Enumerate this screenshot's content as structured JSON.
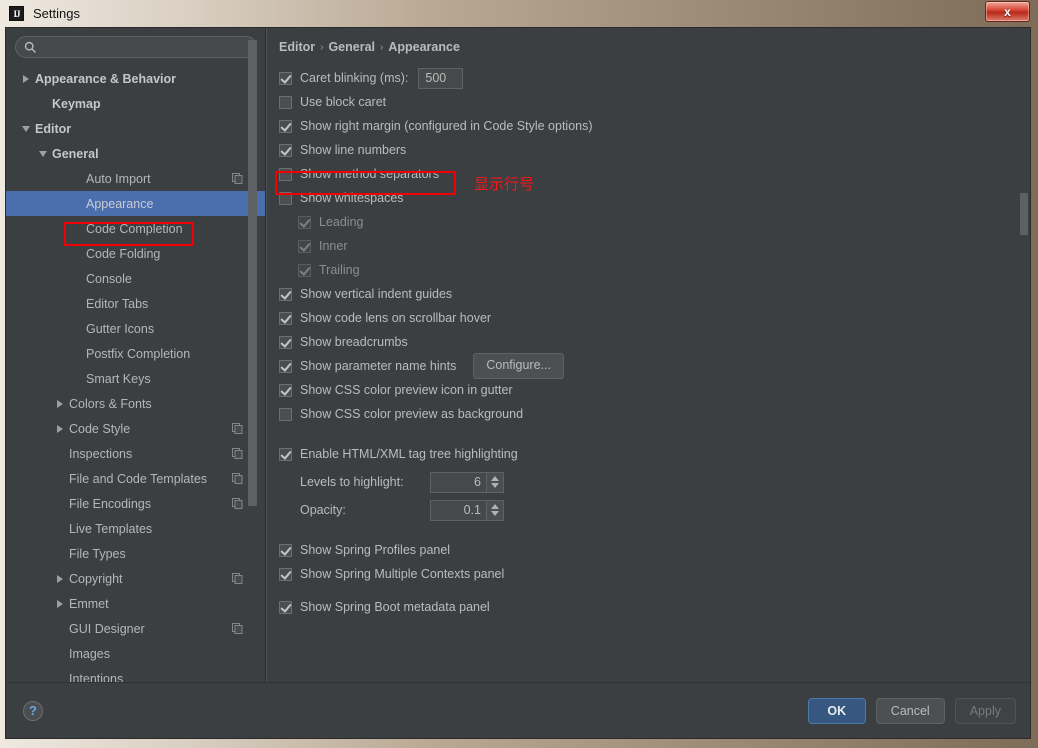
{
  "window": {
    "title": "Settings",
    "app_icon": "intellij-idea-icon",
    "close_label": "x"
  },
  "search": {
    "value": "",
    "placeholder": "",
    "icon": "search-icon"
  },
  "sidebar": {
    "items": [
      {
        "label": "Appearance & Behavior",
        "indent": 0,
        "arrow": "collapsed",
        "bold": true,
        "copy": false,
        "selected": false
      },
      {
        "label": "Keymap",
        "indent": 1,
        "arrow": "none",
        "bold": true,
        "copy": false,
        "selected": false
      },
      {
        "label": "Editor",
        "indent": 0,
        "arrow": "expanded",
        "bold": true,
        "copy": false,
        "selected": false
      },
      {
        "label": "General",
        "indent": 1,
        "arrow": "expanded",
        "bold": true,
        "copy": false,
        "selected": false
      },
      {
        "label": "Auto Import",
        "indent": 3,
        "arrow": "none",
        "bold": false,
        "copy": true,
        "selected": false
      },
      {
        "label": "Appearance",
        "indent": 3,
        "arrow": "none",
        "bold": false,
        "copy": false,
        "selected": true
      },
      {
        "label": "Code Completion",
        "indent": 3,
        "arrow": "none",
        "bold": false,
        "copy": false,
        "selected": false
      },
      {
        "label": "Code Folding",
        "indent": 3,
        "arrow": "none",
        "bold": false,
        "copy": false,
        "selected": false
      },
      {
        "label": "Console",
        "indent": 3,
        "arrow": "none",
        "bold": false,
        "copy": false,
        "selected": false
      },
      {
        "label": "Editor Tabs",
        "indent": 3,
        "arrow": "none",
        "bold": false,
        "copy": false,
        "selected": false
      },
      {
        "label": "Gutter Icons",
        "indent": 3,
        "arrow": "none",
        "bold": false,
        "copy": false,
        "selected": false
      },
      {
        "label": "Postfix Completion",
        "indent": 3,
        "arrow": "none",
        "bold": false,
        "copy": false,
        "selected": false
      },
      {
        "label": "Smart Keys",
        "indent": 3,
        "arrow": "none",
        "bold": false,
        "copy": false,
        "selected": false
      },
      {
        "label": "Colors & Fonts",
        "indent": 2,
        "arrow": "collapsed",
        "bold": false,
        "copy": false,
        "selected": false
      },
      {
        "label": "Code Style",
        "indent": 2,
        "arrow": "collapsed",
        "bold": false,
        "copy": true,
        "selected": false
      },
      {
        "label": "Inspections",
        "indent": 2,
        "arrow": "none",
        "bold": false,
        "copy": true,
        "selected": false
      },
      {
        "label": "File and Code Templates",
        "indent": 2,
        "arrow": "none",
        "bold": false,
        "copy": true,
        "selected": false
      },
      {
        "label": "File Encodings",
        "indent": 2,
        "arrow": "none",
        "bold": false,
        "copy": true,
        "selected": false
      },
      {
        "label": "Live Templates",
        "indent": 2,
        "arrow": "none",
        "bold": false,
        "copy": false,
        "selected": false
      },
      {
        "label": "File Types",
        "indent": 2,
        "arrow": "none",
        "bold": false,
        "copy": false,
        "selected": false
      },
      {
        "label": "Copyright",
        "indent": 2,
        "arrow": "collapsed",
        "bold": false,
        "copy": true,
        "selected": false
      },
      {
        "label": "Emmet",
        "indent": 2,
        "arrow": "collapsed",
        "bold": false,
        "copy": false,
        "selected": false
      },
      {
        "label": "GUI Designer",
        "indent": 2,
        "arrow": "none",
        "bold": false,
        "copy": true,
        "selected": false
      },
      {
        "label": "Images",
        "indent": 2,
        "arrow": "none",
        "bold": false,
        "copy": false,
        "selected": false
      },
      {
        "label": "Intentions",
        "indent": 2,
        "arrow": "none",
        "bold": false,
        "copy": false,
        "selected": false
      }
    ]
  },
  "breadcrumb": {
    "parts": [
      "Editor",
      "General",
      "Appearance"
    ],
    "separator": "›"
  },
  "options": [
    {
      "label": "Caret blinking (ms):",
      "checked": true,
      "disabled": false,
      "indent": 0,
      "control": "text",
      "value": "500"
    },
    {
      "label": "Use block caret",
      "checked": false,
      "disabled": false,
      "indent": 0,
      "control": "none"
    },
    {
      "label": "Show right margin (configured in Code Style options)",
      "checked": true,
      "disabled": false,
      "indent": 0,
      "control": "none"
    },
    {
      "label": "Show line numbers",
      "checked": true,
      "disabled": false,
      "indent": 0,
      "control": "none"
    },
    {
      "label": "Show method separators",
      "checked": false,
      "disabled": false,
      "indent": 0,
      "control": "none"
    },
    {
      "label": "Show whitespaces",
      "checked": false,
      "disabled": false,
      "indent": 0,
      "control": "none"
    },
    {
      "label": "Leading",
      "checked": true,
      "disabled": true,
      "indent": 1,
      "control": "none"
    },
    {
      "label": "Inner",
      "checked": true,
      "disabled": true,
      "indent": 1,
      "control": "none"
    },
    {
      "label": "Trailing",
      "checked": true,
      "disabled": true,
      "indent": 1,
      "control": "none"
    },
    {
      "label": "Show vertical indent guides",
      "checked": true,
      "disabled": false,
      "indent": 0,
      "control": "none"
    },
    {
      "label": "Show code lens on scrollbar hover",
      "checked": true,
      "disabled": false,
      "indent": 0,
      "control": "none"
    },
    {
      "label": "Show breadcrumbs",
      "checked": true,
      "disabled": false,
      "indent": 0,
      "control": "none"
    },
    {
      "label": "Show parameter name hints",
      "checked": true,
      "disabled": false,
      "indent": 0,
      "control": "button",
      "button_label": "Configure..."
    },
    {
      "label": "Show CSS color preview icon in gutter",
      "checked": true,
      "disabled": false,
      "indent": 0,
      "control": "none"
    },
    {
      "label": "Show CSS color preview as background",
      "checked": false,
      "disabled": false,
      "indent": 0,
      "control": "none"
    }
  ],
  "tag_tree": {
    "enable_label": "Enable HTML/XML tag tree highlighting",
    "enable_checked": true,
    "levels_label": "Levels to highlight:",
    "levels_value": "6",
    "opacity_label": "Opacity:",
    "opacity_value": "0.1"
  },
  "spring": [
    {
      "label": "Show Spring Profiles panel",
      "checked": true
    },
    {
      "label": "Show Spring Multiple Contexts panel",
      "checked": true
    },
    {
      "label": "Show Spring Boot metadata panel",
      "checked": true
    }
  ],
  "annotation": {
    "text": "显示行号",
    "color": "#f81616"
  },
  "footer": {
    "help_label": "?",
    "ok_label": "OK",
    "cancel_label": "Cancel",
    "apply_label": "Apply"
  },
  "colors": {
    "selection": "#4b6eaf",
    "highlight_box": "#f00000",
    "default_button": "#365880",
    "panel_bg": "#3c3f41"
  }
}
